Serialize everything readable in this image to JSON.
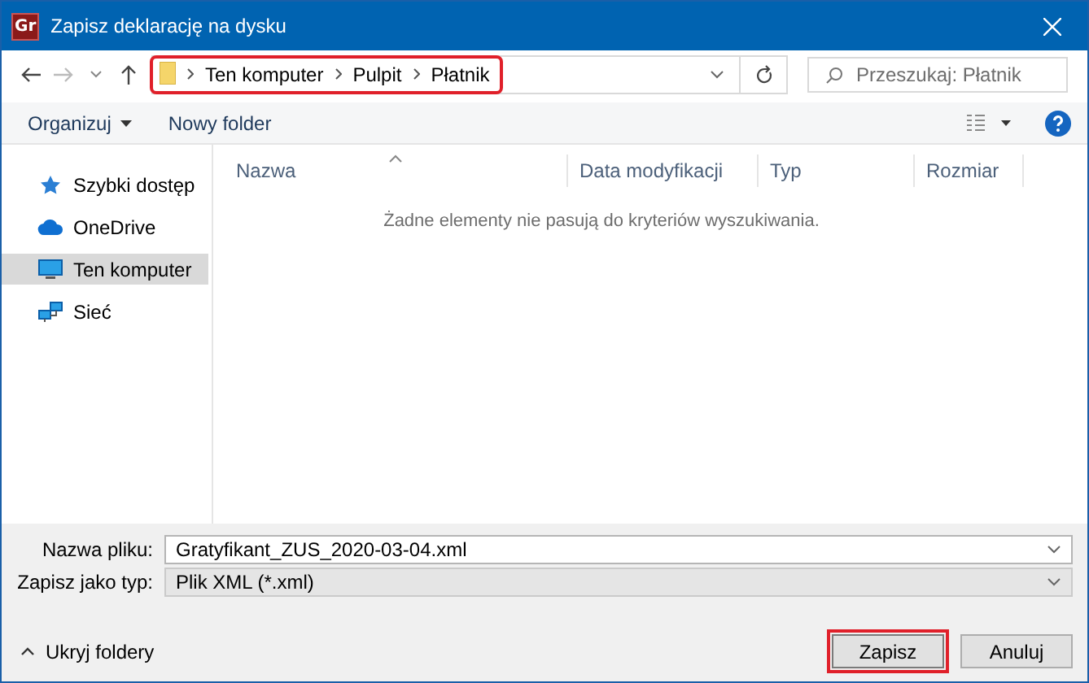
{
  "window": {
    "title": "Zapisz deklarację na dysku",
    "app_icon": "Gr"
  },
  "navigation": {
    "breadcrumb": [
      "Ten komputer",
      "Pulpit",
      "Płatnik"
    ],
    "highlighted": true,
    "search": {
      "placeholder": "Przeszukaj: Płatnik"
    }
  },
  "toolbar": {
    "buttons": [
      {
        "label": "Organizuj",
        "kind": "menu"
      },
      {
        "label": "Nowy folder",
        "kind": "plain"
      }
    ]
  },
  "sidebar": {
    "items": [
      {
        "label": "Szybki dostęp",
        "kind": "star",
        "selected": false
      },
      {
        "label": "OneDrive",
        "kind": "cloud",
        "selected": false
      },
      {
        "label": "Ten komputer",
        "kind": "computer",
        "selected": true
      },
      {
        "label": "Sieć",
        "kind": "network",
        "selected": false
      }
    ]
  },
  "file_list": {
    "columns": [
      "Nazwa",
      "Data modyfikacji",
      "Typ",
      "Rozmiar"
    ],
    "empty_message": "Żadne elementy nie pasują do kryteriów wyszukiwania."
  },
  "save_form": {
    "file_name": {
      "label": "Nazwa pliku:",
      "value": "Gratyfikant_ZUS_2020-03-04.xml"
    },
    "file_type": {
      "label": "Zapisz jako typ:",
      "value": "Plik XML (*.xml)"
    }
  },
  "footer": {
    "toggle": "Ukryj foldery",
    "buttons": [
      {
        "label": "Zapisz",
        "highlighted": true
      },
      {
        "label": "Anuluj",
        "highlighted": false
      }
    ]
  }
}
